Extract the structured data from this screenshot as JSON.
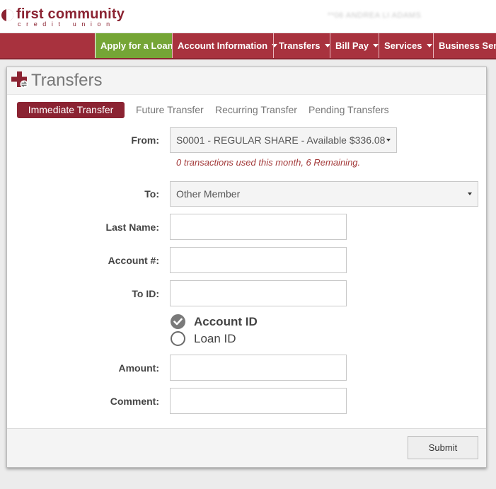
{
  "brand": {
    "name": "first community",
    "tagline": "credit union",
    "color": "#8b2332"
  },
  "header": {
    "user_name": "**06 ANDREA LI ADAMS"
  },
  "nav": {
    "apply_label": "Apply for a Loan",
    "items": [
      {
        "label": "Account Information",
        "dropdown": true
      },
      {
        "label": "Transfers",
        "dropdown": true
      },
      {
        "label": "Bill Pay",
        "dropdown": true
      },
      {
        "label": "Services",
        "dropdown": true
      },
      {
        "label": "Business Serv",
        "dropdown": false
      }
    ]
  },
  "panel": {
    "title": "Transfers",
    "icon": "transfer-plus-icon"
  },
  "tabs": [
    {
      "label": "Immediate Transfer",
      "active": true
    },
    {
      "label": "Future Transfer",
      "active": false
    },
    {
      "label": "Recurring Transfer",
      "active": false
    },
    {
      "label": "Pending Transfers",
      "active": false
    }
  ],
  "form": {
    "from_label": "From:",
    "from_value": "S0001 - REGULAR SHARE - Available $336.08",
    "from_notice": "0 transactions used this month, 6 Remaining.",
    "to_label": "To:",
    "to_value": "Other Member",
    "last_name_label": "Last Name:",
    "last_name_value": "",
    "account_label": "Account #:",
    "account_value": "",
    "to_id_label": "To ID:",
    "to_id_value": "",
    "id_type_options": [
      {
        "label": "Account ID",
        "selected": true
      },
      {
        "label": "Loan ID",
        "selected": false
      }
    ],
    "amount_label": "Amount:",
    "amount_value": "",
    "comment_label": "Comment:",
    "comment_value": ""
  },
  "footer": {
    "submit_label": "Submit"
  }
}
